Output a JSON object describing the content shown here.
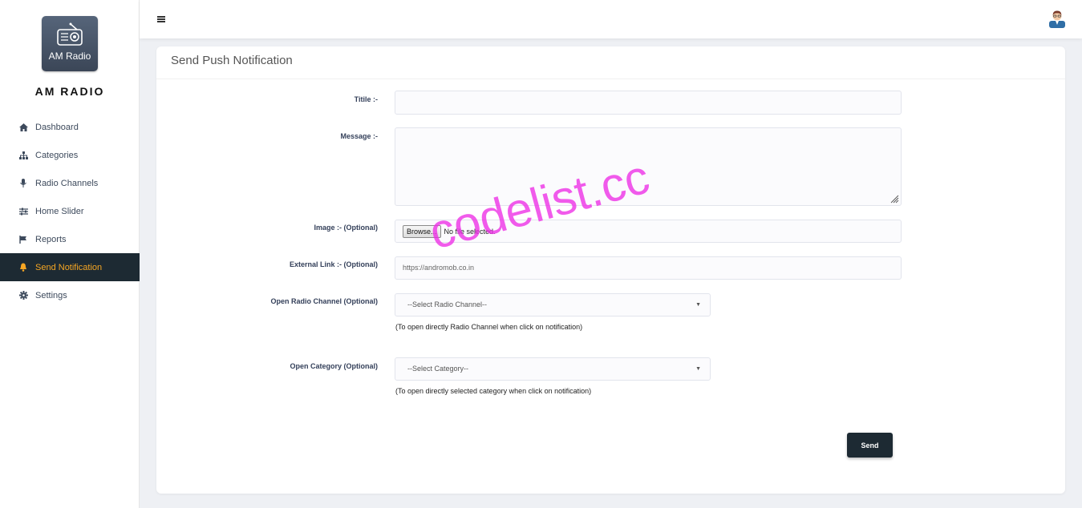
{
  "sidebar": {
    "logo_text": "AM Radio",
    "brand": "AM RADIO",
    "items": [
      {
        "label": "Dashboard",
        "icon": "home-icon",
        "active": false
      },
      {
        "label": "Categories",
        "icon": "sitemap-icon",
        "active": false
      },
      {
        "label": "Radio Channels",
        "icon": "microphone-icon",
        "active": false
      },
      {
        "label": "Home Slider",
        "icon": "sliders-icon",
        "active": false
      },
      {
        "label": "Reports",
        "icon": "flag-icon",
        "active": false
      },
      {
        "label": "Send Notification",
        "icon": "bell-icon",
        "active": true
      },
      {
        "label": "Settings",
        "icon": "gear-icon",
        "active": false
      }
    ]
  },
  "card": {
    "title": "Send Push Notification"
  },
  "form": {
    "title_label": "Titile :-",
    "message_label": "Message :-",
    "image_label": "Image :- (Optional)",
    "browse_label": "Browse...",
    "no_file": "No file selected.",
    "external_label": "External Link :- (Optional)",
    "external_placeholder": "https://andromob.co.in",
    "channel_label": "Open Radio Channel (Optional)",
    "channel_selected": "--Select Radio Channel--",
    "channel_help": "(To open directly Radio Channel when click on notification)",
    "category_label": "Open Category (Optional)",
    "category_selected": "--Select Category--",
    "category_help": "(To open directly selected category when click on notification)",
    "send_label": "Send"
  },
  "watermark": "codelist.cc",
  "colors": {
    "active_bg": "#1d2a33",
    "active_text": "#f6a623",
    "watermark": "#ee2ee6"
  }
}
